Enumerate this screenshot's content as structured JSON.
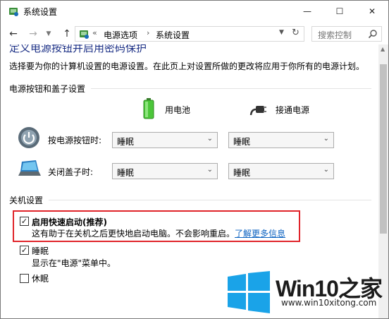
{
  "window": {
    "title": "系统设置",
    "controls": {
      "minimize": "—",
      "maximize": "☐",
      "close": "✕"
    }
  },
  "nav": {
    "back": "←",
    "forward": "→",
    "up": "↑",
    "breadcrumb": [
      "电源选项",
      "系统设置"
    ],
    "overflow_chevron": "«",
    "search_placeholder": "搜索控制"
  },
  "content": {
    "heading_partial": "定义电源按钮并启用密码保护",
    "description": "选择要为你的计算机设置的电源设置。在此页上对设置所做的更改将应用于你所有的电源计划。",
    "power_section_title": "电源按钮和盖子设置",
    "columns": {
      "battery": "用电池",
      "plugged": "接通电源"
    },
    "rows": [
      {
        "label": "按电源按钮时:",
        "battery_value": "睡眠",
        "plugged_value": "睡眠"
      },
      {
        "label": "关闭盖子时:",
        "battery_value": "睡眠",
        "plugged_value": "睡眠"
      }
    ],
    "shutdown_section_title": "关机设置",
    "shutdown_options": [
      {
        "label": "启用快速启动(推荐)",
        "checked": true,
        "description": "这有助于在关机之后更快地启动电脑。不会影响重启。",
        "link": "了解更多信息"
      },
      {
        "label": "睡眠",
        "checked": true,
        "description": "显示在\"电源\"菜单中。"
      },
      {
        "label": "休眠",
        "checked": false,
        "description": ""
      }
    ]
  },
  "watermark": {
    "title": "Win10之家",
    "subtitle": "www.win10xitong.com"
  },
  "colors": {
    "heading": "#1e3287",
    "link": "#0b62c1",
    "highlight_border": "#e0242a",
    "win_logo": "#1aa3e8"
  }
}
